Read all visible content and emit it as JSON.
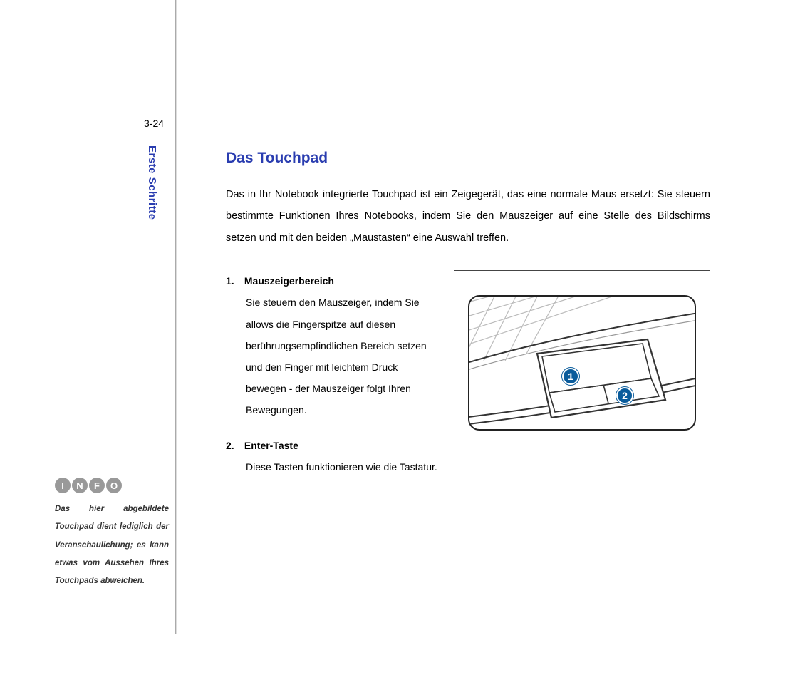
{
  "page_number": "3-24",
  "sidebar_label": "Erste Schritte",
  "info": {
    "icons": [
      "I",
      "N",
      "F",
      "O"
    ],
    "text": "Das hier abgebildete Touchpad dient lediglich der Veranschaulichung; es kann etwas vom Aussehen Ihres Touchpads abweichen."
  },
  "content": {
    "heading": "Das Touchpad",
    "intro": "Das in Ihr Notebook integrierte Touchpad ist ein Zeigegerät, das eine normale Maus ersetzt: Sie steuern bestimmte Funktionen Ihres Notebooks, indem Sie den Mauszeiger auf eine Stelle des Bildschirms setzen und mit den beiden „Maustasten“ eine Auswahl treffen.",
    "items": [
      {
        "num": "1.",
        "title": "Mauszeigerbereich",
        "desc": "Sie steuern den Mauszeiger, indem Sie allows die Fingerspitze auf diesen berührungsempfindlichen Bereich setzen und den Finger mit leichtem Druck bewegen - der Mauszeiger folgt Ihren Bewegungen."
      },
      {
        "num": "2.",
        "title": "Enter-Taste",
        "desc": "Diese Tasten funktionieren wie die Tastatur."
      }
    ],
    "callouts": [
      "1",
      "2"
    ]
  }
}
